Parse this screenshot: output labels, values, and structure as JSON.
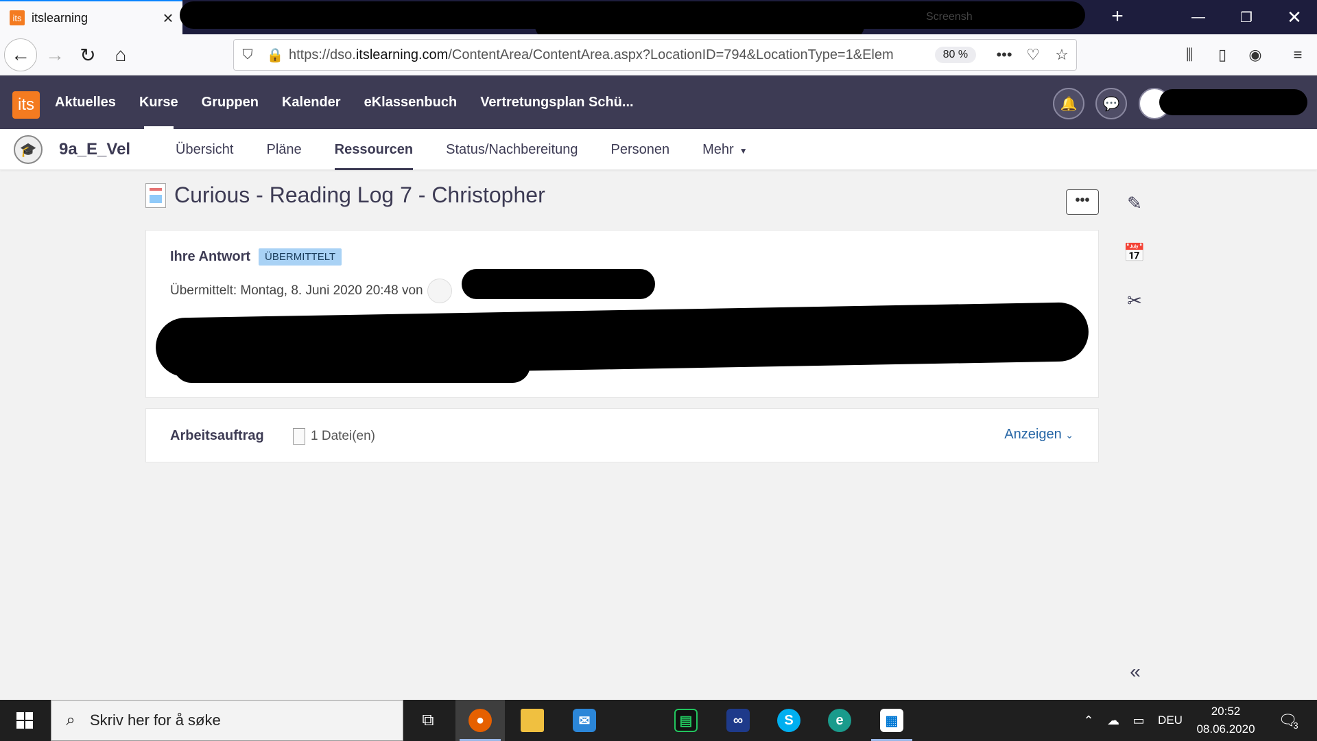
{
  "browser": {
    "tab_title": "itslearning",
    "tab_favicon": "its",
    "other_tab_fragment": "Screensh",
    "url_prefix": "https://dso.",
    "url_domain": "itslearning.com",
    "url_rest": "/ContentArea/ContentArea.aspx?LocationID=794&LocationType=1&Elem",
    "zoom": "80 %"
  },
  "header": {
    "logo": "its",
    "nav": [
      "Aktuelles",
      "Kurse",
      "Gruppen",
      "Kalender",
      "eKlassenbuch",
      "Vertretungsplan Schü..."
    ]
  },
  "course": {
    "name": "9a_E_Vel",
    "tabs": [
      "Übersicht",
      "Pläne",
      "Ressourcen",
      "Status/Nachbereitung",
      "Personen",
      "Mehr"
    ]
  },
  "content": {
    "title": "Curious - Reading Log 7 - Christopher",
    "more_button": "•••",
    "answer": {
      "heading": "Ihre Antwort",
      "badge": "ÜBERMITTELT",
      "submitted": "Übermittelt: Montag, 8. Juni 2020 20:48 von"
    },
    "task": {
      "heading": "Arbeitsauftrag",
      "files": "1 Datei(en)",
      "show_link": "Anzeigen"
    }
  },
  "taskbar": {
    "search_placeholder": "Skriv her for å søke",
    "language": "DEU",
    "time": "20:52",
    "date": "08.06.2020",
    "notification_count": "3"
  },
  "colors": {
    "header_bg": "#3d3b54",
    "accent_orange": "#f47b20",
    "badge_bg": "#a9d2f5",
    "link_blue": "#2565a5"
  }
}
